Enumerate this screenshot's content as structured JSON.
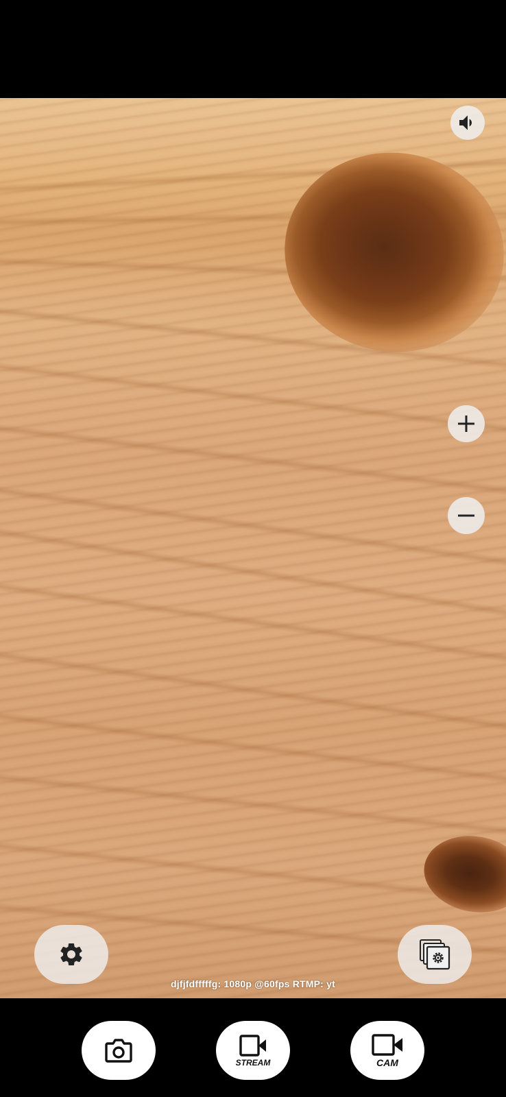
{
  "preview": {
    "status_text": "djfjfdfffffg: 1080p @60fps RTMP: yt"
  },
  "controls": {
    "volume_icon": "speaker-icon",
    "zoom_in_icon": "plus-icon",
    "zoom_out_icon": "minus-icon",
    "settings_icon": "gear-icon",
    "stream_settings_icon": "stacked-frames-gear-icon"
  },
  "modes": {
    "photo_icon": "camera-icon",
    "stream_label": "STREAM",
    "stream_icon": "video-camera-icon",
    "cam_label": "CAM",
    "cam_icon": "video-camera-icon"
  },
  "colors": {
    "bars": "#000000",
    "button_bg": "#eeeeee",
    "icon": "#222222",
    "mode_button_bg": "#ffffff"
  }
}
